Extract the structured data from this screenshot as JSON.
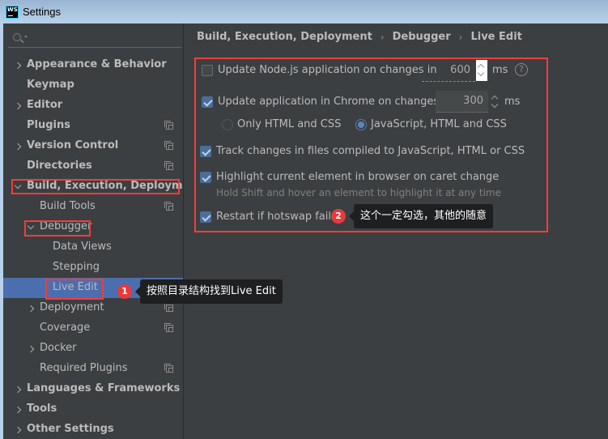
{
  "window": {
    "title": "Settings",
    "app_icon": "webstorm-icon"
  },
  "search": {
    "placeholder": ""
  },
  "sidebar": {
    "items": [
      {
        "label": "Appearance & Behavior",
        "level": 0,
        "expander": "collapsed",
        "bold": true,
        "project_icon": false
      },
      {
        "label": "Keymap",
        "level": 0,
        "expander": "none",
        "bold": true,
        "project_icon": false
      },
      {
        "label": "Editor",
        "level": 0,
        "expander": "collapsed",
        "bold": true,
        "project_icon": false
      },
      {
        "label": "Plugins",
        "level": 0,
        "expander": "none",
        "bold": true,
        "project_icon": true
      },
      {
        "label": "Version Control",
        "level": 0,
        "expander": "collapsed",
        "bold": true,
        "project_icon": true
      },
      {
        "label": "Directories",
        "level": 0,
        "expander": "none",
        "bold": true,
        "project_icon": true
      },
      {
        "label": "Build, Execution, Deployment",
        "level": 0,
        "expander": "expanded",
        "bold": true,
        "project_icon": false
      },
      {
        "label": "Build Tools",
        "level": 1,
        "expander": "none",
        "bold": false,
        "project_icon": true
      },
      {
        "label": "Debugger",
        "level": 1,
        "expander": "expanded",
        "bold": false,
        "project_icon": false
      },
      {
        "label": "Data Views",
        "level": 2,
        "expander": "none",
        "bold": false,
        "project_icon": false
      },
      {
        "label": "Stepping",
        "level": 2,
        "expander": "none",
        "bold": false,
        "project_icon": false
      },
      {
        "label": "Live Edit",
        "level": 2,
        "expander": "none",
        "bold": false,
        "project_icon": false,
        "selected": true
      },
      {
        "label": "Deployment",
        "level": 1,
        "expander": "collapsed",
        "bold": false,
        "project_icon": true
      },
      {
        "label": "Coverage",
        "level": 1,
        "expander": "none",
        "bold": false,
        "project_icon": true
      },
      {
        "label": "Docker",
        "level": 1,
        "expander": "collapsed",
        "bold": false,
        "project_icon": false
      },
      {
        "label": "Required Plugins",
        "level": 1,
        "expander": "none",
        "bold": false,
        "project_icon": true
      },
      {
        "label": "Languages & Frameworks",
        "level": 0,
        "expander": "collapsed",
        "bold": true,
        "project_icon": false
      },
      {
        "label": "Tools",
        "level": 0,
        "expander": "collapsed",
        "bold": true,
        "project_icon": false
      },
      {
        "label": "Other Settings",
        "level": 0,
        "expander": "collapsed",
        "bold": true,
        "project_icon": false
      }
    ]
  },
  "breadcrumb": [
    "Build, Execution, Deployment",
    "Debugger",
    "Live Edit"
  ],
  "options": {
    "update_node": {
      "label": "Update Node.js application on changes in",
      "checked": false,
      "value": "600",
      "unit": "ms"
    },
    "update_chrome": {
      "label": "Update application in Chrome on changes in",
      "checked": true,
      "value": "300",
      "unit": "ms"
    },
    "radio_only_html_css": {
      "label": "Only HTML and CSS",
      "selected": false
    },
    "radio_js_html_css": {
      "label": "JavaScript, HTML and CSS",
      "selected": true
    },
    "track_changes": {
      "label": "Track changes in files compiled to JavaScript, HTML or CSS",
      "checked": true
    },
    "highlight_element": {
      "label": "Highlight current element in browser on caret change",
      "checked": true,
      "hint": "Hold Shift and hover an element to highlight it at any time"
    },
    "restart_hotswap": {
      "label": "Restart if hotswap fails",
      "checked": true
    }
  },
  "annotations": {
    "step1": {
      "number": "1",
      "text": "按照目录结构找到Live Edit"
    },
    "step2": {
      "number": "2",
      "text": "这个一定勾选，其他的随意"
    },
    "highlight_color": "#f53c3c"
  },
  "colors": {
    "background": "#3c3f41",
    "selection": "#4b6eaf",
    "checkbox_checked": "#4a6d9a",
    "titlebar_top": "#99b4d1",
    "titlebar_bottom": "#b9d1ea"
  }
}
